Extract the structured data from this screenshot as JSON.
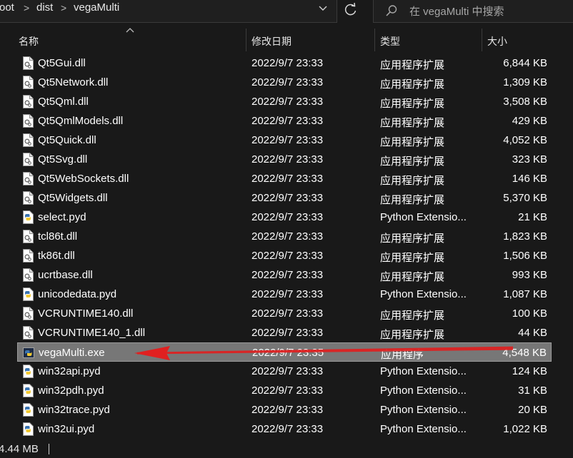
{
  "address": {
    "crumbs": [
      "oot",
      "dist",
      "vegaMulti"
    ],
    "separator": ">"
  },
  "search": {
    "placeholder": "在 vegaMulti 中搜索"
  },
  "columns": {
    "name": "名称",
    "date": "修改日期",
    "type": "类型",
    "size": "大小"
  },
  "files": [
    {
      "name": "Qt5Gui.dll",
      "date": "2022/9/7 23:33",
      "type": "应用程序扩展",
      "size": "6,844 KB",
      "icon": "dll-file-icon"
    },
    {
      "name": "Qt5Network.dll",
      "date": "2022/9/7 23:33",
      "type": "应用程序扩展",
      "size": "1,309 KB",
      "icon": "dll-file-icon"
    },
    {
      "name": "Qt5Qml.dll",
      "date": "2022/9/7 23:33",
      "type": "应用程序扩展",
      "size": "3,508 KB",
      "icon": "dll-file-icon"
    },
    {
      "name": "Qt5QmlModels.dll",
      "date": "2022/9/7 23:33",
      "type": "应用程序扩展",
      "size": "429 KB",
      "icon": "dll-file-icon"
    },
    {
      "name": "Qt5Quick.dll",
      "date": "2022/9/7 23:33",
      "type": "应用程序扩展",
      "size": "4,052 KB",
      "icon": "dll-file-icon"
    },
    {
      "name": "Qt5Svg.dll",
      "date": "2022/9/7 23:33",
      "type": "应用程序扩展",
      "size": "323 KB",
      "icon": "dll-file-icon"
    },
    {
      "name": "Qt5WebSockets.dll",
      "date": "2022/9/7 23:33",
      "type": "应用程序扩展",
      "size": "146 KB",
      "icon": "dll-file-icon"
    },
    {
      "name": "Qt5Widgets.dll",
      "date": "2022/9/7 23:33",
      "type": "应用程序扩展",
      "size": "5,370 KB",
      "icon": "dll-file-icon"
    },
    {
      "name": "select.pyd",
      "date": "2022/9/7 23:33",
      "type": "Python Extensio...",
      "size": "21 KB",
      "icon": "python-file-icon"
    },
    {
      "name": "tcl86t.dll",
      "date": "2022/9/7 23:33",
      "type": "应用程序扩展",
      "size": "1,823 KB",
      "icon": "dll-file-icon"
    },
    {
      "name": "tk86t.dll",
      "date": "2022/9/7 23:33",
      "type": "应用程序扩展",
      "size": "1,506 KB",
      "icon": "dll-file-icon"
    },
    {
      "name": "ucrtbase.dll",
      "date": "2022/9/7 23:33",
      "type": "应用程序扩展",
      "size": "993 KB",
      "icon": "dll-file-icon"
    },
    {
      "name": "unicodedata.pyd",
      "date": "2022/9/7 23:33",
      "type": "Python Extensio...",
      "size": "1,087 KB",
      "icon": "python-file-icon"
    },
    {
      "name": "VCRUNTIME140.dll",
      "date": "2022/9/7 23:33",
      "type": "应用程序扩展",
      "size": "100 KB",
      "icon": "dll-file-icon"
    },
    {
      "name": "VCRUNTIME140_1.dll",
      "date": "2022/9/7 23:33",
      "type": "应用程序扩展",
      "size": "44 KB",
      "icon": "dll-file-icon"
    },
    {
      "name": "vegaMulti.exe",
      "date": "2022/9/7 23:35",
      "type": "应用程序",
      "size": "4,548 KB",
      "icon": "exe-file-icon",
      "selected": true
    },
    {
      "name": "win32api.pyd",
      "date": "2022/9/7 23:33",
      "type": "Python Extensio...",
      "size": "124 KB",
      "icon": "python-file-icon"
    },
    {
      "name": "win32pdh.pyd",
      "date": "2022/9/7 23:33",
      "type": "Python Extensio...",
      "size": "31 KB",
      "icon": "python-file-icon"
    },
    {
      "name": "win32trace.pyd",
      "date": "2022/9/7 23:33",
      "type": "Python Extensio...",
      "size": "20 KB",
      "icon": "python-file-icon"
    },
    {
      "name": "win32ui.pyd",
      "date": "2022/9/7 23:33",
      "type": "Python Extensio...",
      "size": "1,022 KB",
      "icon": "python-file-icon"
    }
  ],
  "status": {
    "text": "4.44 MB"
  },
  "colors": {
    "background": "#191919",
    "selected_row": "#777777",
    "annotation_arrow": "#e02020"
  }
}
